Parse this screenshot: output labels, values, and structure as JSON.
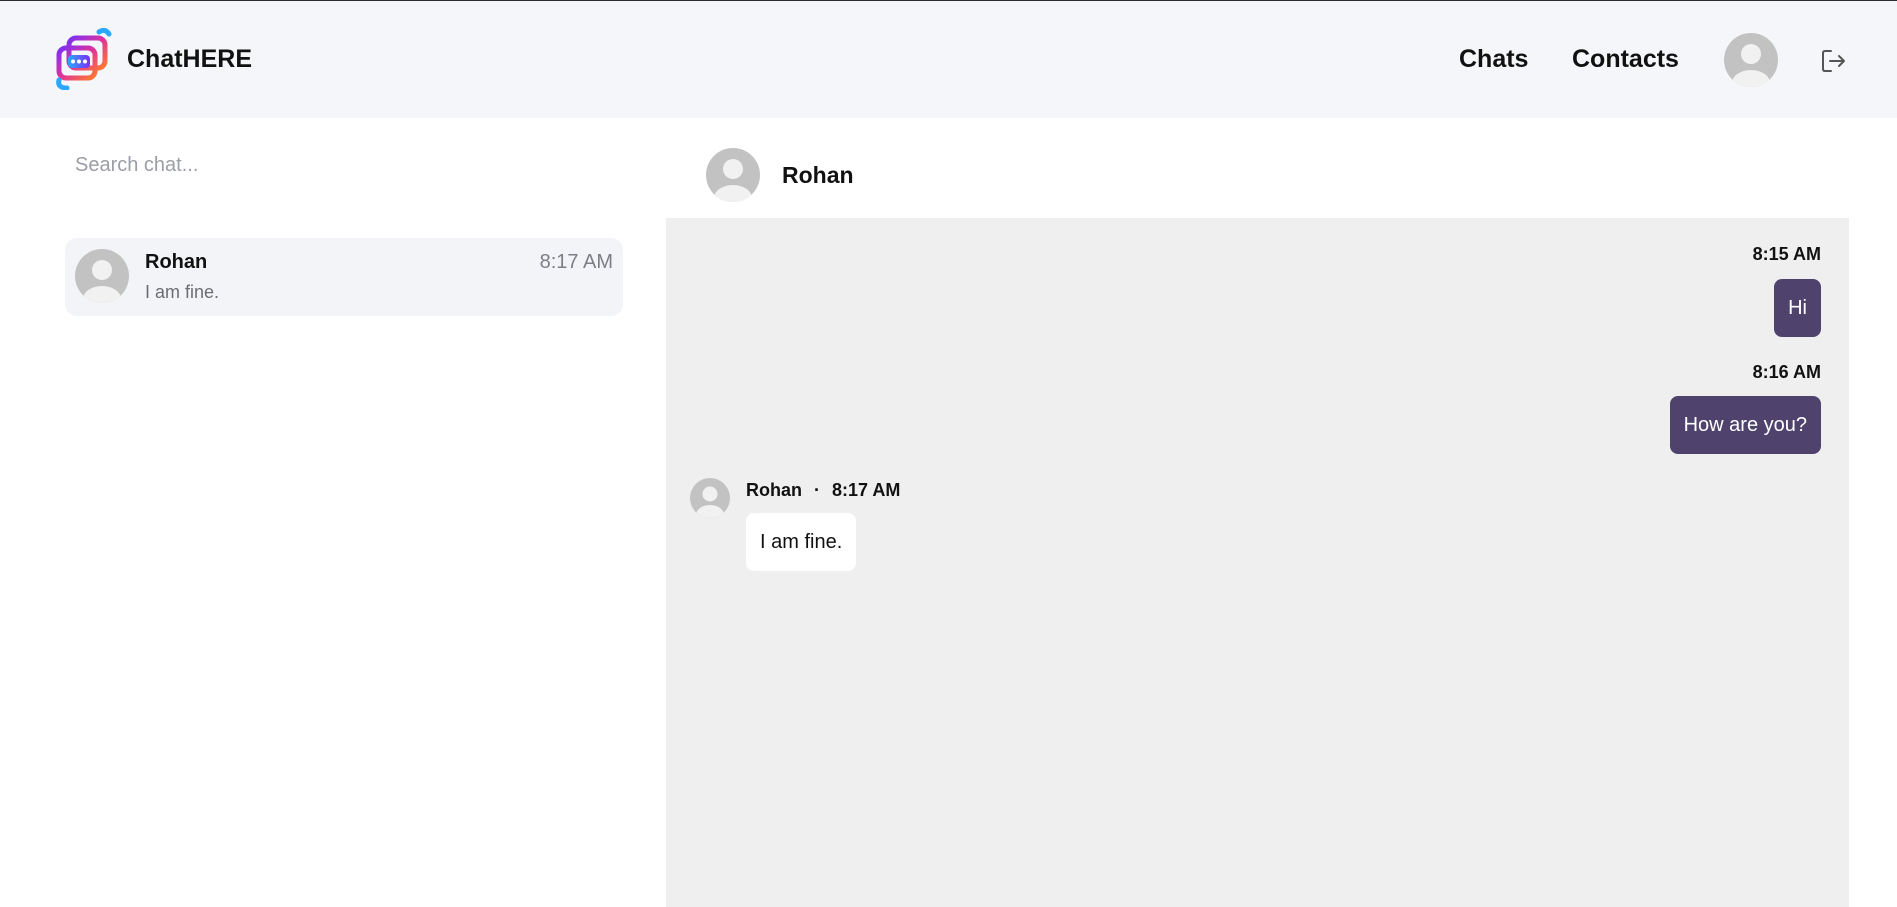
{
  "app": {
    "name": "ChatHERE"
  },
  "nav": {
    "chats": "Chats",
    "contacts": "Contacts"
  },
  "icons": {
    "logo": "chat-bubbles-logo-icon",
    "avatar": "user-avatar-icon",
    "logout": "logout-icon"
  },
  "colors": {
    "header_bg": "#f5f6fa",
    "outgoing_bubble": "#4f436e",
    "conversation_bg": "#efefef",
    "incoming_bubble": "#ffffff"
  },
  "sidebar": {
    "search_placeholder": "Search chat...",
    "chats": [
      {
        "name": "Rohan",
        "time": "8:17 AM",
        "preview": "I am fine."
      }
    ]
  },
  "conversation": {
    "contact_name": "Rohan",
    "messages": [
      {
        "direction": "outgoing",
        "time": "8:15 AM",
        "text": "Hi"
      },
      {
        "direction": "outgoing",
        "time": "8:16 AM",
        "text": "How are you?"
      },
      {
        "direction": "incoming",
        "sender": "Rohan",
        "separator": "·",
        "time": "8:17 AM",
        "text": "I am fine."
      }
    ]
  }
}
